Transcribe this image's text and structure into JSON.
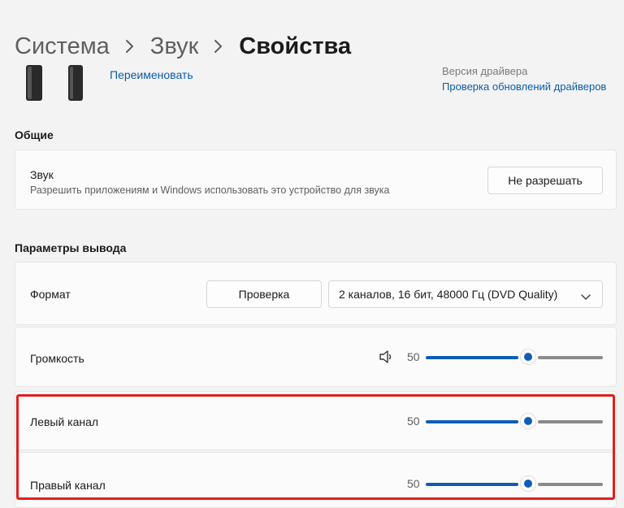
{
  "breadcrumb": {
    "item1": "Система",
    "item2": "Звук",
    "current": "Свойства"
  },
  "device": {
    "rename_link": "Переименовать"
  },
  "driver": {
    "version_text": "Версия драйвера",
    "check_updates_link": "Проверка обновлений драйверов"
  },
  "general": {
    "title": "Общие",
    "sound": {
      "title": "Звук",
      "subtitle": "Разрешить приложениям и Windows использовать это устройство для звука",
      "button": "Не разрешать"
    }
  },
  "output": {
    "title": "Параметры вывода",
    "format": {
      "label": "Формат",
      "test_button": "Проверка",
      "selected": "2 каналов, 16 бит, 48000 Гц (DVD Quality)"
    },
    "volume": {
      "label": "Громкость",
      "value": "50",
      "level": 0.5
    },
    "left": {
      "label": "Левый канал",
      "value": "50",
      "level": 0.5
    },
    "right": {
      "label": "Правый канал",
      "value": "50",
      "level": 0.5
    }
  },
  "colors": {
    "accent": "#0e5cb5",
    "link": "#0b5cad",
    "highlight": "#e01f1f"
  },
  "icons": {
    "volume": "speaker-icon",
    "chevron": "chevron-down-icon",
    "sep": "chevron-right-icon"
  }
}
